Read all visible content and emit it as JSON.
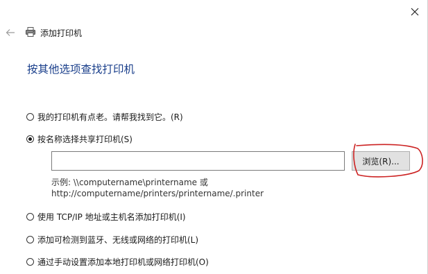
{
  "window": {
    "header_title": "添加打印机",
    "icons": {
      "close": "close-icon",
      "back": "back-arrow-icon",
      "printer": "printer-icon"
    }
  },
  "page": {
    "title": "按其他选项查找打印机"
  },
  "options": [
    {
      "label": "我的打印机有点老。请帮我找到它。(R)",
      "checked": false
    },
    {
      "label": "按名称选择共享打印机(S)",
      "checked": true
    },
    {
      "label": "使用 TCP/IP 地址或主机名添加打印机(I)",
      "checked": false
    },
    {
      "label": "添加可检测到蓝牙、无线或网络的打印机(L)",
      "checked": false
    },
    {
      "label": "通过手动设置添加本地打印机或网络打印机(O)",
      "checked": false
    }
  ],
  "shared_printer": {
    "input_value": "",
    "browse_label": "浏览(R)...",
    "example_line1": "示例: \\\\computername\\printername 或",
    "example_line2": "http://computername/printers/printername/.printer"
  },
  "colors": {
    "title": "#1a3f8b",
    "annotation": "#cc2222",
    "button_bg": "#e1e1e1"
  }
}
